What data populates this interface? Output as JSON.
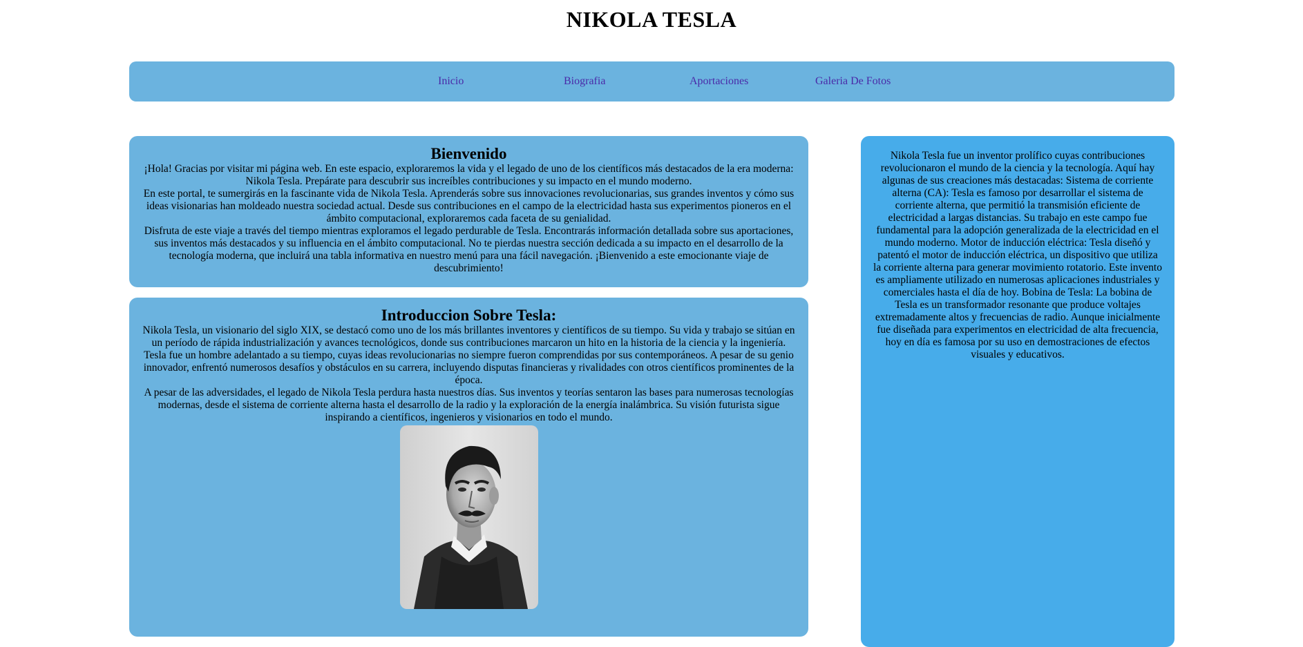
{
  "header": {
    "title": "NIKOLA TESLA"
  },
  "nav": {
    "items": [
      {
        "label": "Inicio"
      },
      {
        "label": "Biografia"
      },
      {
        "label": "Aportaciones"
      },
      {
        "label": "Galeria De Fotos"
      }
    ]
  },
  "welcome": {
    "heading": "Bienvenido",
    "paragraphs": [
      "¡Hola! Gracias por visitar mi página web. En este espacio, exploraremos la vida y el legado de uno de los científicos más destacados de la era moderna: Nikola Tesla. Prepárate para descubrir sus increíbles contribuciones y su impacto en el mundo moderno.",
      "En este portal, te sumergirás en la fascinante vida de Nikola Tesla. Aprenderás sobre sus innovaciones revolucionarias, sus grandes inventos y cómo sus ideas visionarias han moldeado nuestra sociedad actual. Desde sus contribuciones en el campo de la electricidad hasta sus experimentos pioneros en el ámbito computacional, exploraremos cada faceta de su genialidad.",
      "Disfruta de este viaje a través del tiempo mientras exploramos el legado perdurable de Tesla. Encontrarás información detallada sobre sus aportaciones, sus inventos más destacados y su influencia en el ámbito computacional. No te pierdas nuestra sección dedicada a su impacto en el desarrollo de la tecnología moderna, que incluirá una tabla informativa en nuestro menú para una fácil navegación. ¡Bienvenido a este emocionante viaje de descubrimiento!"
    ]
  },
  "intro": {
    "heading": "Introduccion Sobre Tesla:",
    "paragraphs": [
      "Nikola Tesla, un visionario del siglo XIX, se destacó como uno de los más brillantes inventores y científicos de su tiempo. Su vida y trabajo se sitúan en un período de rápida industrialización y avances tecnológicos, donde sus contribuciones marcaron un hito en la historia de la ciencia y la ingeniería.",
      "Tesla fue un hombre adelantado a su tiempo, cuyas ideas revolucionarias no siempre fueron comprendidas por sus contemporáneos. A pesar de su genio innovador, enfrentó numerosos desafíos y obstáculos en su carrera, incluyendo disputas financieras y rivalidades con otros científicos prominentes de la época.",
      "A pesar de las adversidades, el legado de Nikola Tesla perdura hasta nuestros días. Sus inventos y teorías sentaron las bases para numerosas tecnologías modernas, desde el sistema de corriente alterna hasta el desarrollo de la radio y la exploración de la energía inalámbrica. Su visión futurista sigue inspirando a científicos, ingenieros y visionarios en todo el mundo."
    ]
  },
  "sidebar": {
    "text": "Nikola Tesla fue un inventor prolífico cuyas contribuciones revolucionaron el mundo de la ciencia y la tecnología. Aquí hay algunas de sus creaciones más destacadas: Sistema de corriente alterna (CA): Tesla es famoso por desarrollar el sistema de corriente alterna, que permitió la transmisión eficiente de electricidad a largas distancias. Su trabajo en este campo fue fundamental para la adopción generalizada de la electricidad en el mundo moderno. Motor de inducción eléctrica: Tesla diseñó y patentó el motor de inducción eléctrica, un dispositivo que utiliza la corriente alterna para generar movimiento rotatorio. Este invento es ampliamente utilizado en numerosas aplicaciones industriales y comerciales hasta el día de hoy. Bobina de Tesla: La bobina de Tesla es un transformador resonante que produce voltajes extremadamente altos y frecuencias de radio. Aunque inicialmente fue diseñada para experimentos en electricidad de alta frecuencia, hoy en día es famosa por su uso en demostraciones de efectos visuales y educativos."
  },
  "colors": {
    "card_background": "#6bb3df",
    "side_panel_background": "#47acea",
    "nav_link": "#4a2aa8"
  }
}
